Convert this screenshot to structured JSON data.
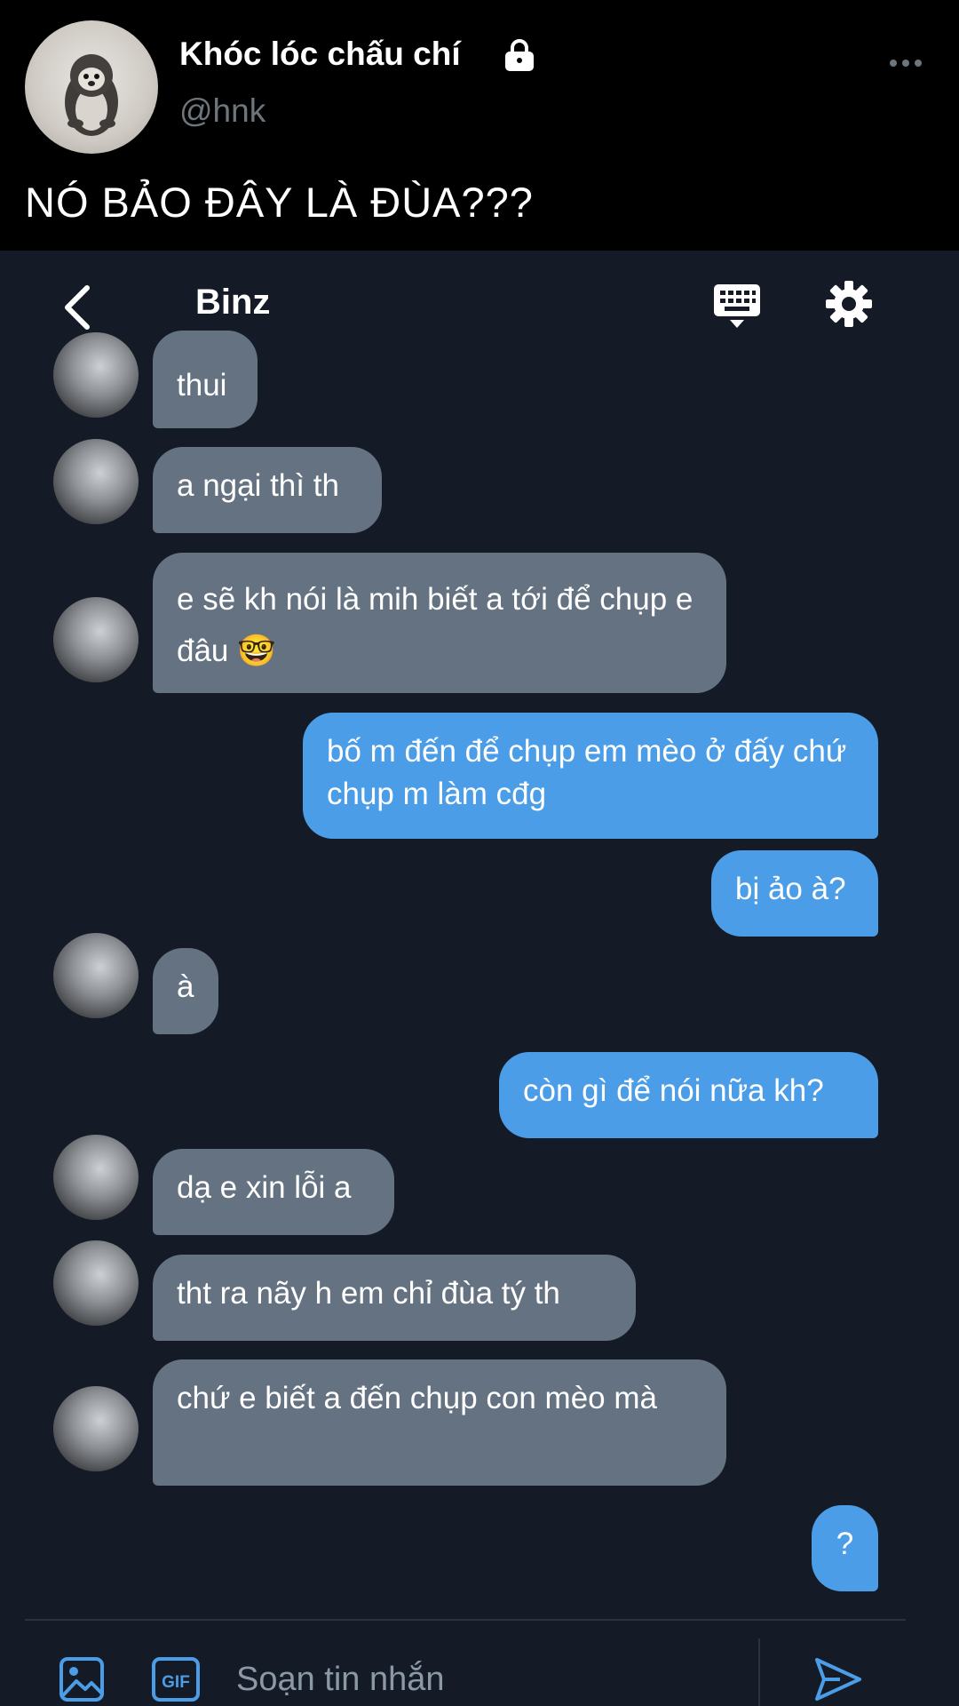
{
  "tweet": {
    "display_name": "Khóc lóc chấu chí",
    "handle": "@hnk",
    "text": "NÓ BẢO ĐÂY LÀ ĐÙA???"
  },
  "dm": {
    "title": "Binz",
    "messages": [
      {
        "side": "in",
        "text": "thui"
      },
      {
        "side": "in",
        "text": "a ngại thì th"
      },
      {
        "side": "in",
        "text": "e sẽ kh nói là mih biết a tới để chụp e đâu 🤓"
      },
      {
        "side": "out",
        "text": "bố m đến để chụp em mèo ở đấy chứ chụp m làm cđg"
      },
      {
        "side": "out",
        "text": "bị ảo à?"
      },
      {
        "side": "in",
        "text": "à"
      },
      {
        "side": "out",
        "text": "còn gì để nói nữa kh?"
      },
      {
        "side": "in",
        "text": "dạ e xin lỗi a"
      },
      {
        "side": "in",
        "text": "tht ra nãy h em chỉ đùa tý th"
      },
      {
        "side": "in",
        "text": "chứ e biết a đến chụp con mèo mà"
      },
      {
        "side": "out",
        "text": "?"
      }
    ],
    "composer": {
      "placeholder": "Soạn tin nhắn",
      "gif_label": "GIF"
    }
  },
  "colors": {
    "incoming_bubble": "#647282",
    "outgoing_bubble": "#4b9de8",
    "dm_background": "#141b26"
  },
  "icons": [
    "lock-icon",
    "more-icon",
    "back-icon",
    "keyboard-icon",
    "gear-icon",
    "image-icon",
    "gif-icon",
    "send-icon"
  ]
}
